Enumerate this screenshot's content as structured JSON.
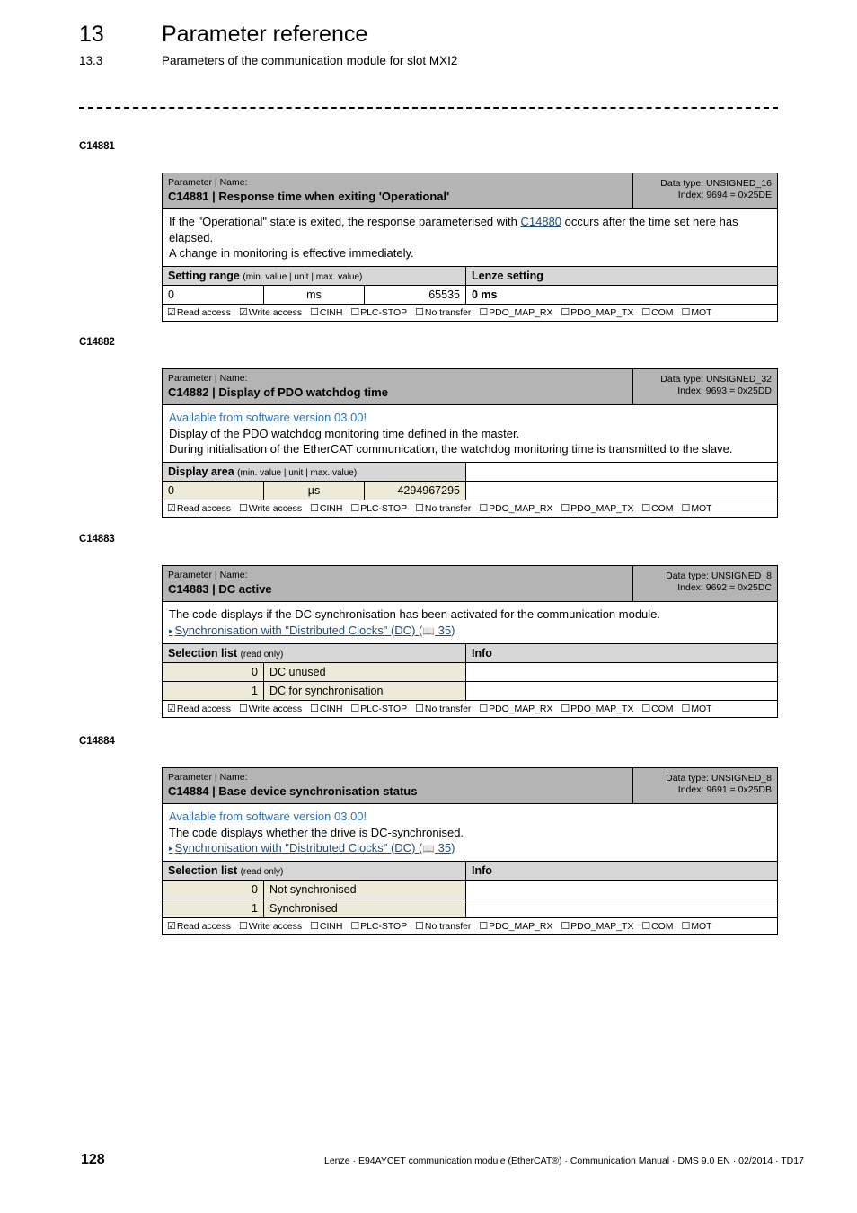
{
  "header": {
    "chapter_number": "13",
    "chapter_title": "Parameter reference",
    "section_number": "13.3",
    "section_title": "Parameters of the communication module for slot MXI2"
  },
  "colors": {
    "head_band": "#b4b4b4",
    "subhead_band": "#d7d7d7",
    "value_beige": "#edeada",
    "link_dark_blue": "#1f4e79",
    "note_blue": "#2f75b5"
  },
  "common": {
    "kicker": "Parameter | Name:",
    "data_type_prefix": "Data type: ",
    "index_prefix": "Index: ",
    "setting_range_label": "Setting range",
    "setting_range_hint": "(min. value | unit | max. value)",
    "display_area_label": "Display area",
    "display_area_hint": "(min. value | unit | max. value)",
    "lenze_setting_label": "Lenze setting",
    "selection_list_label": "Selection list",
    "selection_list_hint": "(read only)",
    "info_label": "Info",
    "available_note": "Available from software version 03.00!",
    "dc_link_bullet": "▸",
    "dc_link_text": "Synchronisation with \"Distributed Clocks\" (DC)",
    "dc_link_open": " (",
    "dc_link_book": "📖",
    "dc_link_page": " 35)",
    "flags": [
      {
        "label": "Read access",
        "checked": true
      },
      {
        "label": "Write access",
        "checked": false
      },
      {
        "label": "CINH",
        "checked": false
      },
      {
        "label": "PLC-STOP",
        "checked": false
      },
      {
        "label": "No transfer",
        "checked": false
      },
      {
        "label": "PDO_MAP_RX",
        "checked": false
      },
      {
        "label": "PDO_MAP_TX",
        "checked": false
      },
      {
        "label": "COM",
        "checked": false
      },
      {
        "label": "MOT",
        "checked": false
      }
    ],
    "box_checked": "☑",
    "box_unchecked": "☐"
  },
  "sections": [
    {
      "label": "C14881",
      "param_name": "C14881 | Response time when exiting 'Operational'",
      "data_type": "Data type: UNSIGNED_16",
      "index": "Index: 9694 = 0x25DE",
      "desc_line1_a": "If the \"Operational\" state is exited, the response parameterised with ",
      "desc_link": "C14880",
      "desc_line1_b": " occurs after the time set here has elapsed.",
      "desc_line2": "A change in monitoring is effective immediately.",
      "range_label": "Setting range",
      "range_hint": "(min. value | unit | max. value)",
      "right_head": "Lenze setting",
      "min": "0",
      "unit": "ms",
      "max": "65535",
      "lenze": "0 ms",
      "flags_read": true,
      "flags_write": true
    },
    {
      "label": "C14882",
      "param_name": "C14882 | Display of PDO watchdog time",
      "data_type": "Data type: UNSIGNED_32",
      "index": "Index: 9693 = 0x25DD",
      "note": "Available from software version 03.00!",
      "desc_line1": "Display of the PDO watchdog monitoring time defined in the master.",
      "desc_line2": "During initialisation of the EtherCAT communication, the watchdog monitoring time is transmitted to the slave.",
      "range_label": "Display area",
      "range_hint": "(min. value | unit | max. value)",
      "right_head": "",
      "min": "0",
      "unit": "µs",
      "max": "4294967295",
      "flags_read": true,
      "flags_write": false
    },
    {
      "label": "C14883",
      "param_name": "C14883 | DC active",
      "data_type": "Data type: UNSIGNED_8",
      "index": "Index: 9692 = 0x25DC",
      "desc_line1": "The code displays if the DC synchronisation has been activated for the communication module.",
      "selection": [
        {
          "code": "0",
          "text": "DC unused",
          "info": ""
        },
        {
          "code": "1",
          "text": "DC for synchronisation",
          "info": ""
        }
      ],
      "flags_read": true,
      "flags_write": false
    },
    {
      "label": "C14884",
      "param_name": "C14884 | Base device synchronisation status",
      "data_type": "Data type: UNSIGNED_8",
      "index": "Index: 9691 = 0x25DB",
      "note": "Available from software version 03.00!",
      "desc_line1": "The code displays whether the drive is DC-synchronised.",
      "selection": [
        {
          "code": "0",
          "text": "Not synchronised",
          "info": ""
        },
        {
          "code": "1",
          "text": "Synchronised",
          "info": ""
        }
      ],
      "flags_read": true,
      "flags_write": false
    }
  ],
  "footer": {
    "page_number": "128",
    "text": "Lenze · E94AYCET communication module (EtherCAT®) · Communication Manual · DMS 9.0 EN · 02/2014 · TD17"
  }
}
